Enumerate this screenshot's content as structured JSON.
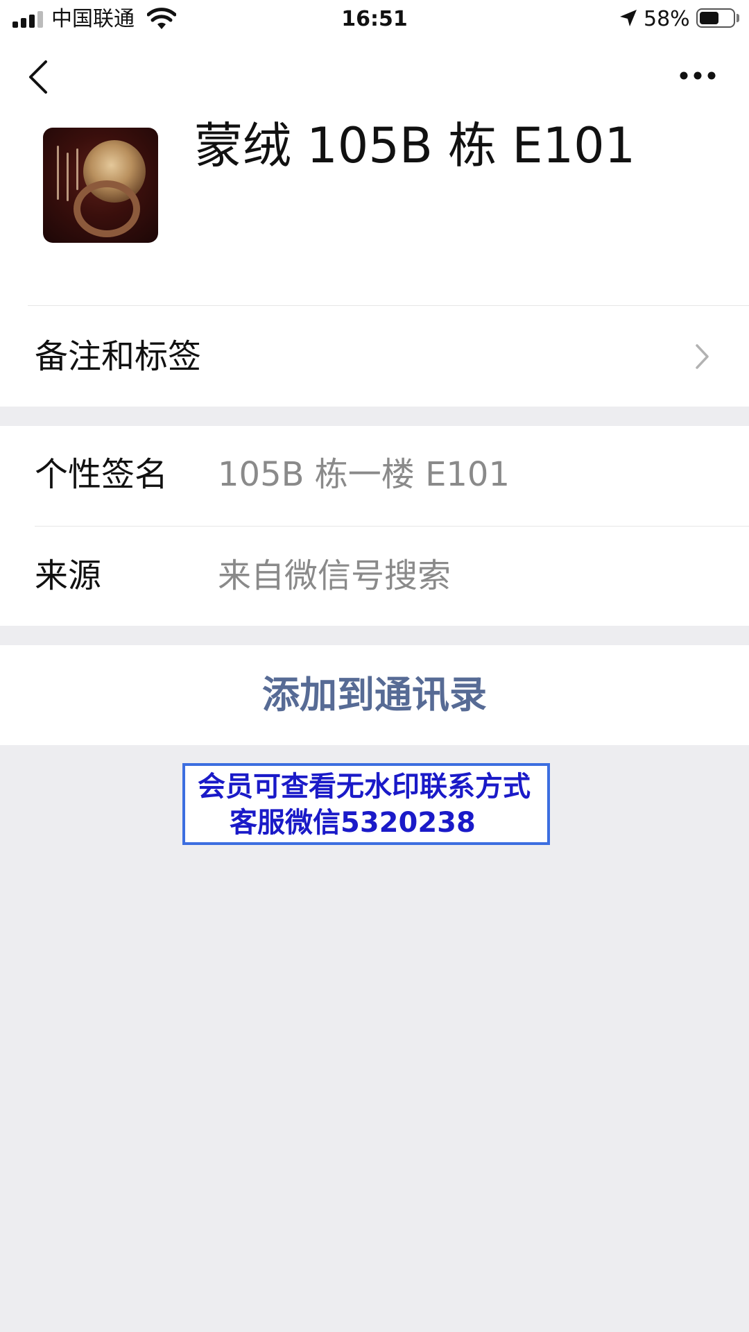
{
  "status_bar": {
    "carrier": "中国联通",
    "time": "16:51",
    "battery_percent": "58%",
    "battery_level": 0.58
  },
  "nav": {
    "back_icon": "chevron-left-icon",
    "more_icon": "ellipsis-icon"
  },
  "profile": {
    "name": "蒙绒 105B 栋 E101"
  },
  "remarks_row": {
    "label": "备注和标签"
  },
  "signature_row": {
    "label": "个性签名",
    "value": "105B 栋一楼 E101"
  },
  "source_row": {
    "label": "来源",
    "value": "来自微信号搜索"
  },
  "add_button": {
    "label": "添加到通讯录"
  },
  "watermark": {
    "line1": "会员可查看无水印联系方式",
    "line2": "客服微信5320238"
  },
  "colors": {
    "background": "#ededf0",
    "link_blue": "#576b95",
    "watermark_text": "#1a1ac8",
    "watermark_border": "#3c6ee0"
  }
}
